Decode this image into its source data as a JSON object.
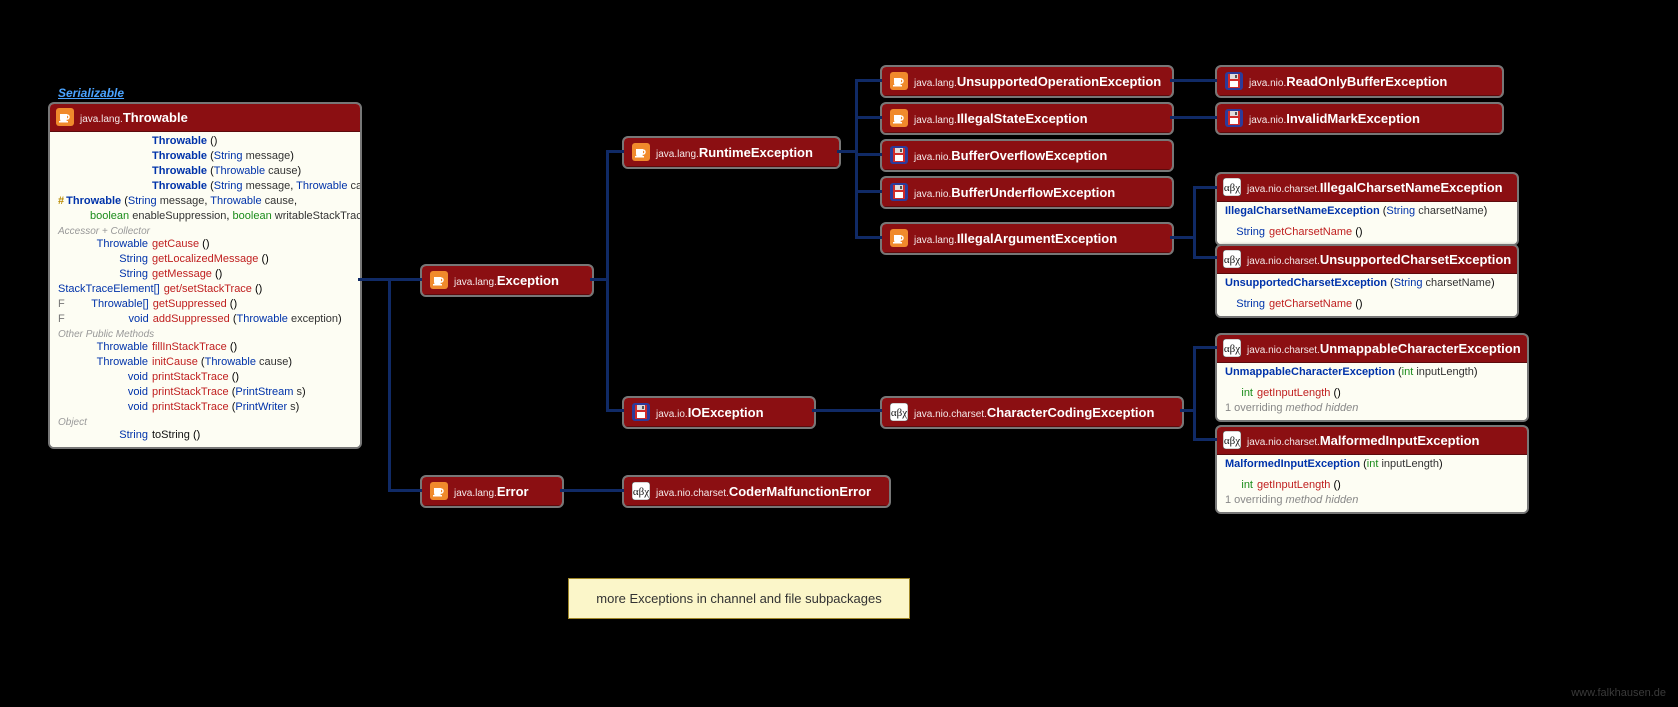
{
  "labels": {
    "serializable": "Serializable",
    "watermark": "www.falkhausen.de",
    "note": "more Exceptions in channel and file subpackages"
  },
  "throwable": {
    "pkg": "java.lang.",
    "name": "Throwable",
    "ctors": [
      {
        "sig": "Throwable",
        "params": "()"
      },
      {
        "sig": "Throwable",
        "params": "(String message)"
      },
      {
        "sig": "Throwable",
        "params": "(Throwable cause)"
      },
      {
        "sig": "Throwable",
        "params": "(String message, Throwable cause)"
      }
    ],
    "protCtor": {
      "sig": "Throwable",
      "paramsLine1": "(String message, Throwable cause,",
      "paramsLine2": "boolean enableSuppression, boolean writableStackTrace)"
    },
    "section1": "Accessor + Collector",
    "acc": [
      {
        "ret": "Throwable",
        "name": "getCause",
        "params": "()"
      },
      {
        "ret": "String",
        "name": "getLocalizedMessage",
        "params": "()"
      },
      {
        "ret": "String",
        "name": "getMessage",
        "params": "()"
      },
      {
        "ret": "StackTraceElement[]",
        "name": "get/setStackTrace",
        "params": "()"
      },
      {
        "ret": "Throwable[]",
        "name": "getSuppressed",
        "params": "()"
      },
      {
        "ret": "void",
        "name": "addSuppressed",
        "params": "(Throwable exception)"
      }
    ],
    "section2": "Other Public Methods",
    "pub": [
      {
        "ret": "Throwable",
        "name": "fillInStackTrace",
        "params": "()"
      },
      {
        "ret": "Throwable",
        "name": "initCause",
        "params": "(Throwable cause)"
      },
      {
        "ret": "void",
        "name": "printStackTrace",
        "params": "()"
      },
      {
        "ret": "void",
        "name": "printStackTrace",
        "params": "(PrintStream s)"
      },
      {
        "ret": "void",
        "name": "printStackTrace",
        "params": "(PrintWriter s)"
      }
    ],
    "section3": "Object",
    "obj": [
      {
        "ret": "String",
        "name": "toString",
        "params": "()"
      }
    ]
  },
  "nodes": {
    "exception": {
      "pkg": "java.lang.",
      "name": "Exception",
      "icon": "cup"
    },
    "error": {
      "pkg": "java.lang.",
      "name": "Error",
      "icon": "cup"
    },
    "runtime": {
      "pkg": "java.lang.",
      "name": "RuntimeException",
      "icon": "cup"
    },
    "ioexception": {
      "pkg": "java.io.",
      "name": "IOException",
      "icon": "disk"
    },
    "codermal": {
      "pkg": "java.nio.charset.",
      "name": "CoderMalfunctionError",
      "icon": "abg"
    },
    "unsupop": {
      "pkg": "java.lang.",
      "name": "UnsupportedOperationException",
      "icon": "cup"
    },
    "illstate": {
      "pkg": "java.lang.",
      "name": "IllegalStateException",
      "icon": "cup"
    },
    "bufovf": {
      "pkg": "java.nio.",
      "name": "BufferOverflowException",
      "icon": "disk"
    },
    "bufund": {
      "pkg": "java.nio.",
      "name": "BufferUnderflowException",
      "icon": "disk"
    },
    "illarg": {
      "pkg": "java.lang.",
      "name": "IllegalArgumentException",
      "icon": "cup"
    },
    "readonly": {
      "pkg": "java.nio.",
      "name": "ReadOnlyBufferException",
      "icon": "disk"
    },
    "invmark": {
      "pkg": "java.nio.",
      "name": "InvalidMarkException",
      "icon": "disk"
    },
    "charcoding": {
      "pkg": "java.nio.charset.",
      "name": "CharacterCodingException",
      "icon": "abg"
    }
  },
  "illCharset": {
    "pkg": "java.nio.charset.",
    "name": "IllegalCharsetNameException",
    "ctor": {
      "sig": "IllegalCharsetNameException",
      "params": "(String charsetName)"
    },
    "method": {
      "ret": "String",
      "name": "getCharsetName",
      "params": "()"
    }
  },
  "unsupCharset": {
    "pkg": "java.nio.charset.",
    "name": "UnsupportedCharsetException",
    "ctor": {
      "sig": "UnsupportedCharsetException",
      "params": "(String charsetName)"
    },
    "method": {
      "ret": "String",
      "name": "getCharsetName",
      "params": "()"
    }
  },
  "unmappable": {
    "pkg": "java.nio.charset.",
    "name": "UnmappableCharacterException",
    "ctor": {
      "sig": "UnmappableCharacterException",
      "params": "(int inputLength)"
    },
    "method": {
      "ret": "int",
      "name": "getInputLength",
      "params": "()"
    },
    "note": "1 overriding method hidden"
  },
  "malformed": {
    "pkg": "java.nio.charset.",
    "name": "MalformedInputException",
    "ctor": {
      "sig": "MalformedInputException",
      "params": "(int inputLength)"
    },
    "method": {
      "ret": "int",
      "name": "getInputLength",
      "params": "()"
    },
    "note": "1 overriding method hidden"
  },
  "colors": {
    "header": "#8b0f12",
    "edge": "#102a66"
  }
}
